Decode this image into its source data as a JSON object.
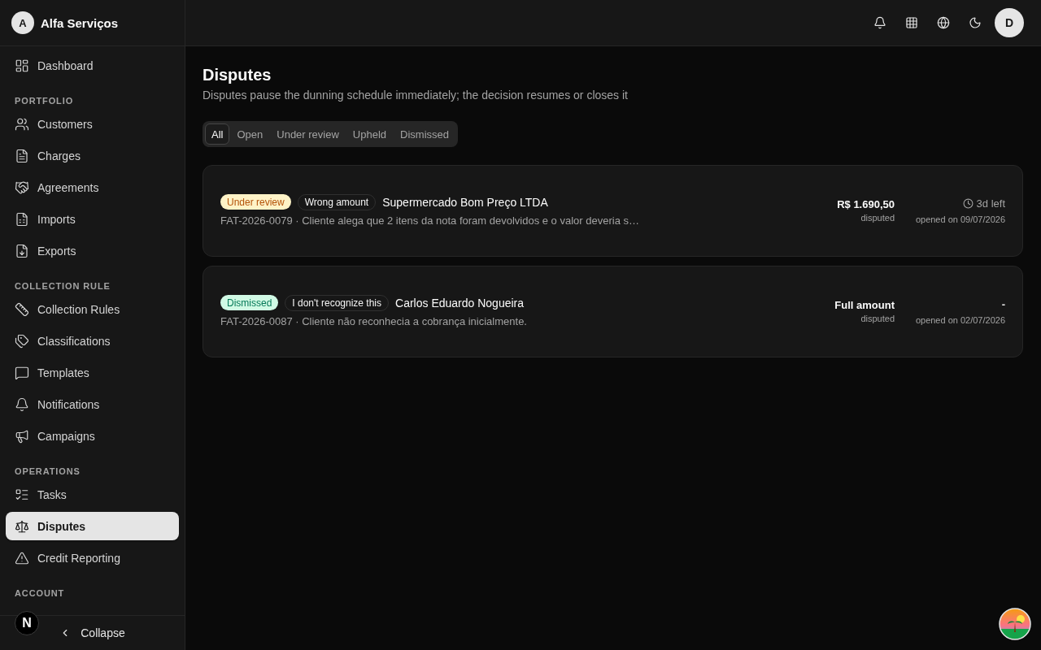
{
  "sidebar": {
    "brand": {
      "initial": "A",
      "name": "Alfa Serviços"
    },
    "sections": [
      {
        "items": [
          {
            "label": "Dashboard",
            "selected": false
          }
        ]
      },
      {
        "title": "PORTFOLIO",
        "items": [
          {
            "label": "Customers",
            "selected": false
          },
          {
            "label": "Charges",
            "selected": false
          },
          {
            "label": "Agreements",
            "selected": false
          },
          {
            "label": "Imports",
            "selected": false
          },
          {
            "label": "Exports",
            "selected": false
          }
        ]
      },
      {
        "title": "COLLECTION RULE",
        "items": [
          {
            "label": "Collection Rules",
            "selected": false
          },
          {
            "label": "Classifications",
            "selected": false
          },
          {
            "label": "Templates",
            "selected": false
          },
          {
            "label": "Notifications",
            "selected": false
          },
          {
            "label": "Campaigns",
            "selected": false
          }
        ]
      },
      {
        "title": "OPERATIONS",
        "items": [
          {
            "label": "Tasks",
            "selected": false
          },
          {
            "label": "Disputes",
            "selected": true
          },
          {
            "label": "Credit Reporting",
            "selected": false
          }
        ]
      },
      {
        "title": "ACCOUNT"
      }
    ],
    "collapse": "Collapse"
  },
  "dev_indicator": {
    "letter": "N"
  },
  "topbar": {
    "avatar": "D"
  },
  "page": {
    "title": "Disputes",
    "subtitle": "Disputes pause the dunning schedule immediately; the decision resumes or closes it"
  },
  "tabs": [
    {
      "label": "All",
      "selected": true
    },
    {
      "label": "Open",
      "selected": false
    },
    {
      "label": "Under review",
      "selected": false
    },
    {
      "label": "Upheld",
      "selected": false
    },
    {
      "label": "Dismissed",
      "selected": false
    }
  ],
  "disputes": [
    {
      "status": "Under review",
      "kind": "pending",
      "reason": "Wrong amount",
      "customer": "Supermercado Bom Preço LTDA",
      "meta": "FAT-2026-0079 · Cliente alega que 2 itens da nota foram devolvidos e o valor deveria s…",
      "amount": "R$ 1.690,50",
      "amount_note": "disputed",
      "countdown": true,
      "deadline": "3d left",
      "opened": "opened on 09/07/2026"
    },
    {
      "status": "Dismissed",
      "kind": "closed",
      "reason": "I don't recognize this",
      "customer": "Carlos Eduardo Nogueira",
      "meta": "FAT-2026-0087 · Cliente não reconhecia a cobrança inicialmente.",
      "amount": "Full amount",
      "amount_note": "disputed",
      "countdown": false,
      "deadline": "-",
      "opened": "opened on 02/07/2026"
    }
  ]
}
